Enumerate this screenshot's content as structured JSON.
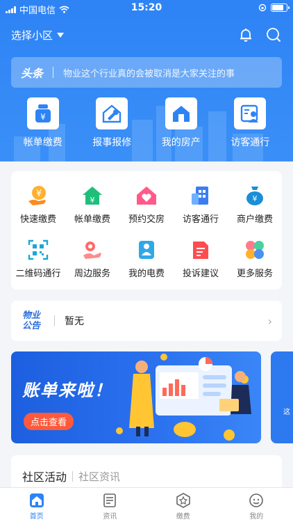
{
  "statusbar": {
    "carrier": "中国电信",
    "time": "15:20"
  },
  "header": {
    "community_label": "选择小区"
  },
  "headline": {
    "logo": "头条",
    "text": "物业这个行业真的会被取消是大家关注的事"
  },
  "top_menu": [
    {
      "label": "帐单缴费",
      "icon": "bill-icon"
    },
    {
      "label": "报事报修",
      "icon": "repair-icon"
    },
    {
      "label": "我的房产",
      "icon": "house-icon"
    },
    {
      "label": "访客通行",
      "icon": "visitor-icon"
    }
  ],
  "services": [
    {
      "label": "快速缴费",
      "icon": "quick-pay-icon"
    },
    {
      "label": "帐单缴费",
      "icon": "bill-pay-icon"
    },
    {
      "label": "预约交房",
      "icon": "appointment-icon"
    },
    {
      "label": "访客通行",
      "icon": "visitor-pass-icon"
    },
    {
      "label": "商户缴费",
      "icon": "merchant-pay-icon"
    },
    {
      "label": "二维码通行",
      "icon": "qrcode-icon"
    },
    {
      "label": "周边服务",
      "icon": "nearby-icon"
    },
    {
      "label": "我的电费",
      "icon": "electric-icon"
    },
    {
      "label": "投诉建议",
      "icon": "complaint-icon"
    },
    {
      "label": "更多服务",
      "icon": "more-icon"
    }
  ],
  "notice": {
    "logo_line1": "物业",
    "logo_line2": "公告",
    "text": "暂无"
  },
  "banner": {
    "title": "账单来啦！",
    "button": "点击查看",
    "next_text": "这"
  },
  "activity": {
    "title": "社区活动",
    "subtitle": "社区资讯"
  },
  "tabs": [
    {
      "label": "首页",
      "icon": "home-icon",
      "active": true
    },
    {
      "label": "资讯",
      "icon": "news-icon",
      "active": false
    },
    {
      "label": "缴费",
      "icon": "pay-icon",
      "active": false
    },
    {
      "label": "我的",
      "icon": "profile-icon",
      "active": false
    }
  ],
  "colors": {
    "primary": "#2e83f5",
    "orange": "#ff9a1f",
    "green": "#1fbf7a",
    "pink": "#ff5a8a",
    "red": "#ff4d4f",
    "cyan": "#1aa7d8"
  }
}
